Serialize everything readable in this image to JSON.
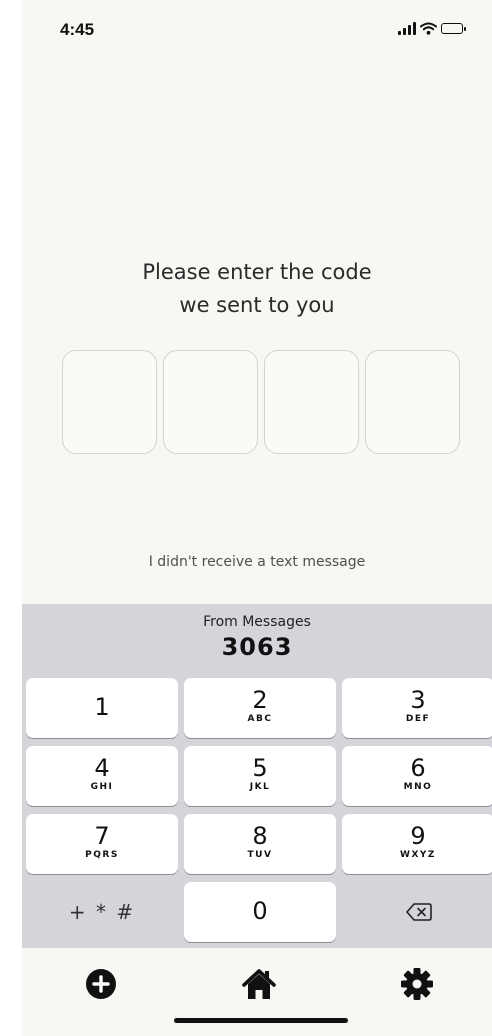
{
  "status_bar": {
    "time": "4:45",
    "signal_icon": "signal-bars-icon",
    "wifi_icon": "wifi-icon",
    "battery_icon": "battery-icon"
  },
  "verification": {
    "title_line1": "Please enter the code",
    "title_line2": "we sent to you",
    "code_digits": [
      "",
      "",
      "",
      ""
    ],
    "resend_label": "I didn't receive a text message"
  },
  "keyboard": {
    "suggestion_source": "From Messages",
    "suggestion_code": "3063",
    "keys": [
      {
        "digit": "1",
        "letters": ""
      },
      {
        "digit": "2",
        "letters": "ABC"
      },
      {
        "digit": "3",
        "letters": "DEF"
      },
      {
        "digit": "4",
        "letters": "GHI"
      },
      {
        "digit": "5",
        "letters": "JKL"
      },
      {
        "digit": "6",
        "letters": "MNO"
      },
      {
        "digit": "7",
        "letters": "PQRS"
      },
      {
        "digit": "8",
        "letters": "TUV"
      },
      {
        "digit": "9",
        "letters": "WXYZ"
      },
      {
        "digit": "0",
        "letters": ""
      }
    ],
    "symbols_label": "+ * #",
    "delete_icon": "backspace-icon"
  },
  "nav": {
    "add_icon": "plus-circle-icon",
    "home_icon": "home-icon",
    "settings_icon": "gear-icon"
  },
  "colors": {
    "background": "#f8f7f3",
    "keyboard_background": "#d3d5da",
    "box_border": "#d5d3ce",
    "text": "#2a2a2a"
  }
}
